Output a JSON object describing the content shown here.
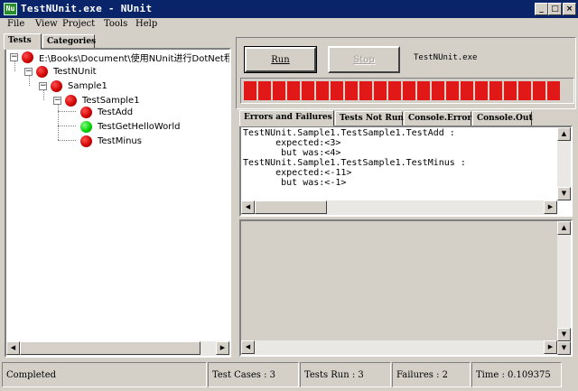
{
  "window": {
    "title": "TestNUnit.exe - NUnit",
    "icon": "nunit-app-icon"
  },
  "menu": {
    "items": [
      "File",
      "View",
      "Project",
      "Tools",
      "Help"
    ]
  },
  "left_tabs": [
    "Tests",
    "Categories"
  ],
  "tree": {
    "root": "E:\\Books\\Document\\使用NUnit进行DotNet程序",
    "project": "TestNUnit",
    "namespace": "Sample1",
    "fixture": "TestSample1",
    "tests": [
      {
        "name": "TestAdd",
        "status": "failed"
      },
      {
        "name": "TestGetHelloWorld",
        "status": "passed"
      },
      {
        "name": "TestMinus",
        "status": "failed"
      }
    ]
  },
  "toolbar": {
    "run_label": "Run",
    "stop_label": "Stop",
    "assembly": "TestNUnit.exe"
  },
  "progress": {
    "fraction": 1.0,
    "color": "#e01818"
  },
  "right_tabs": [
    "Errors and Failures",
    "Tests Not Run",
    "Console.Error",
    "Console.Out"
  ],
  "errors": {
    "line1": "TestNUnit.Sample1.TestSample1.TestAdd :",
    "line2": "      expected:<3>",
    "line3": "       but was:<4>",
    "line4": "TestNUnit.Sample1.TestSample1.TestMinus :",
    "line5": "      expected:<-11>",
    "line6": "       but was:<-1>"
  },
  "status": {
    "state": "Completed",
    "test_cases": "Test Cases : 3",
    "tests_run": "Tests Run : 3",
    "failures": "Failures : 2",
    "time": "Time : 0.109375"
  },
  "colors": {
    "titlebar": "#0a246a",
    "failed": "#cc0000",
    "passed": "#00cc00"
  }
}
